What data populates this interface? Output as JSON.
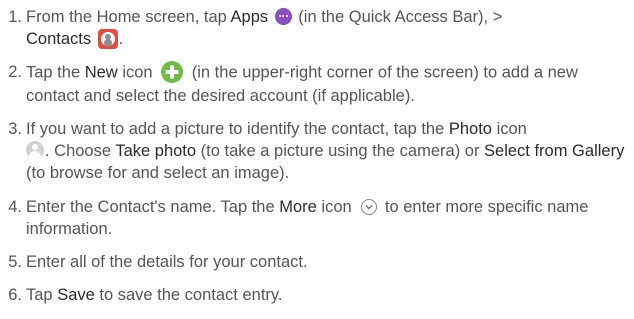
{
  "steps": [
    {
      "number": "1.",
      "parts": [
        {
          "t": "From the Home screen, tap "
        },
        {
          "t": "Apps",
          "bold": true
        },
        {
          "icon": "apps-icon"
        },
        {
          "t": " (in the Quick Access Bar), > "
        },
        {
          "t": "Contacts",
          "bold": true
        },
        {
          "icon": "contacts-icon"
        },
        {
          "t": "."
        }
      ]
    },
    {
      "number": "2.",
      "parts": [
        {
          "t": "Tap the "
        },
        {
          "t": "New",
          "bold": true
        },
        {
          "t": " icon "
        },
        {
          "icon": "new-icon"
        },
        {
          "t": " (in the upper-right corner of the screen) to add a new contact and select the desired account (if applicable)."
        }
      ]
    },
    {
      "number": "3.",
      "parts": [
        {
          "t": "If you want to add a picture to identify the contact, tap the "
        },
        {
          "t": "Photo",
          "bold": true
        },
        {
          "t": " icon "
        },
        {
          "icon": "photo-icon"
        },
        {
          "t": ". Choose "
        },
        {
          "t": "Take photo",
          "bold": true
        },
        {
          "t": " (to take a picture using the camera) or "
        },
        {
          "t": "Select from Gallery",
          "bold": true
        },
        {
          "t": " (to browse for and select an image)."
        }
      ]
    },
    {
      "number": "4.",
      "parts": [
        {
          "t": "Enter the Contact's name. Tap the "
        },
        {
          "t": "More",
          "bold": true
        },
        {
          "t": " icon "
        },
        {
          "icon": "more-icon"
        },
        {
          "t": " to enter more specific name information."
        }
      ]
    },
    {
      "number": "5.",
      "parts": [
        {
          "t": "Enter all of the details for your contact."
        }
      ]
    },
    {
      "number": "6.",
      "parts": [
        {
          "t": "Tap "
        },
        {
          "t": "Save",
          "bold": true
        },
        {
          "t": " to save the contact entry."
        }
      ]
    }
  ],
  "colors": {
    "text": "#555555",
    "emphasis": "#2b2b2b",
    "apps_icon": "#8a4fc3",
    "contacts_icon": "#e84a3d",
    "new_icon": "#6fbe44",
    "photo_icon": "#cfd3d6"
  }
}
